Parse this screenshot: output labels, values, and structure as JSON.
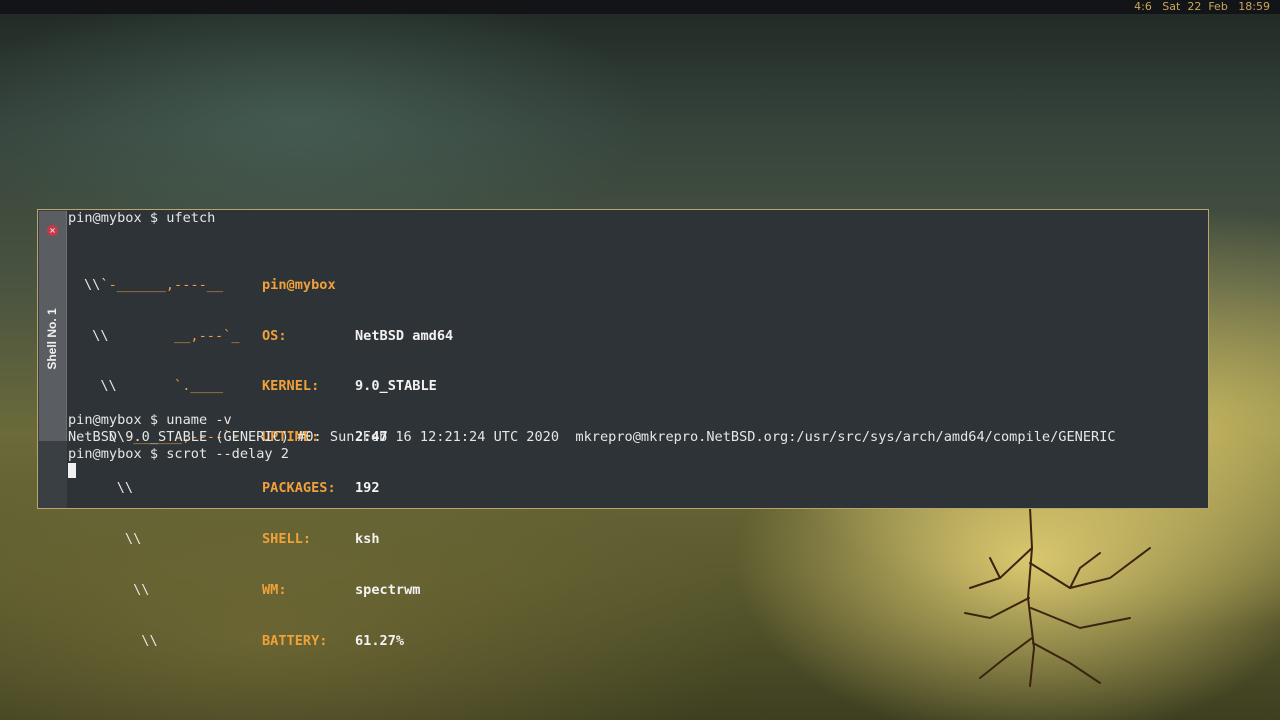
{
  "topbar": {
    "status": "4:6   Sat  22  Feb   18:59"
  },
  "terminal": {
    "tab": {
      "label": "Shell No. 1"
    },
    "lines": {
      "cmd1": "pin@mybox $ ufetch",
      "cmd2": "pin@mybox $ uname -v",
      "output2": "NetBSD 9.0_STABLE (GENERIC) #0: Sun Feb 16 12:21:24 UTC 2020  mkrepro@mkrepro.NetBSD.org:/usr/src/sys/arch/amd64/compile/GENERIC",
      "cmd3": "pin@mybox $ scrot --delay 2"
    },
    "ascii_art": [
      {
        "w": "\\\\`",
        "o": "-______,----__"
      },
      {
        "w": " \\\\",
        "o": "        __,---`_"
      },
      {
        "w": "  \\\\",
        "o": "       `.____"
      },
      {
        "w": "   \\\\",
        "o": "-______,----`-"
      },
      {
        "w": "    \\\\",
        "o": ""
      },
      {
        "w": "     \\\\",
        "o": ""
      },
      {
        "w": "      \\\\",
        "o": ""
      },
      {
        "w": "       \\\\",
        "o": ""
      }
    ],
    "ufetch": {
      "user_host": "pin@mybox",
      "rows": [
        {
          "key": "OS:",
          "value": "NetBSD amd64"
        },
        {
          "key": "KERNEL:",
          "value": "9.0_STABLE"
        },
        {
          "key": "UPTIME:",
          "value": "2:47"
        },
        {
          "key": "PACKAGES:",
          "value": "192"
        },
        {
          "key": "SHELL:",
          "value": "ksh"
        },
        {
          "key": "WM:",
          "value": "spectrwm"
        },
        {
          "key": "BATTERY:",
          "value": "61.27%"
        }
      ]
    }
  },
  "colors": {
    "accent": "#efa13a",
    "terminal_bg": "#2e3338",
    "statusbar_text": "#c9a85a",
    "close_button": "#c7384a"
  },
  "icons": {
    "tab_close": "close-icon"
  }
}
